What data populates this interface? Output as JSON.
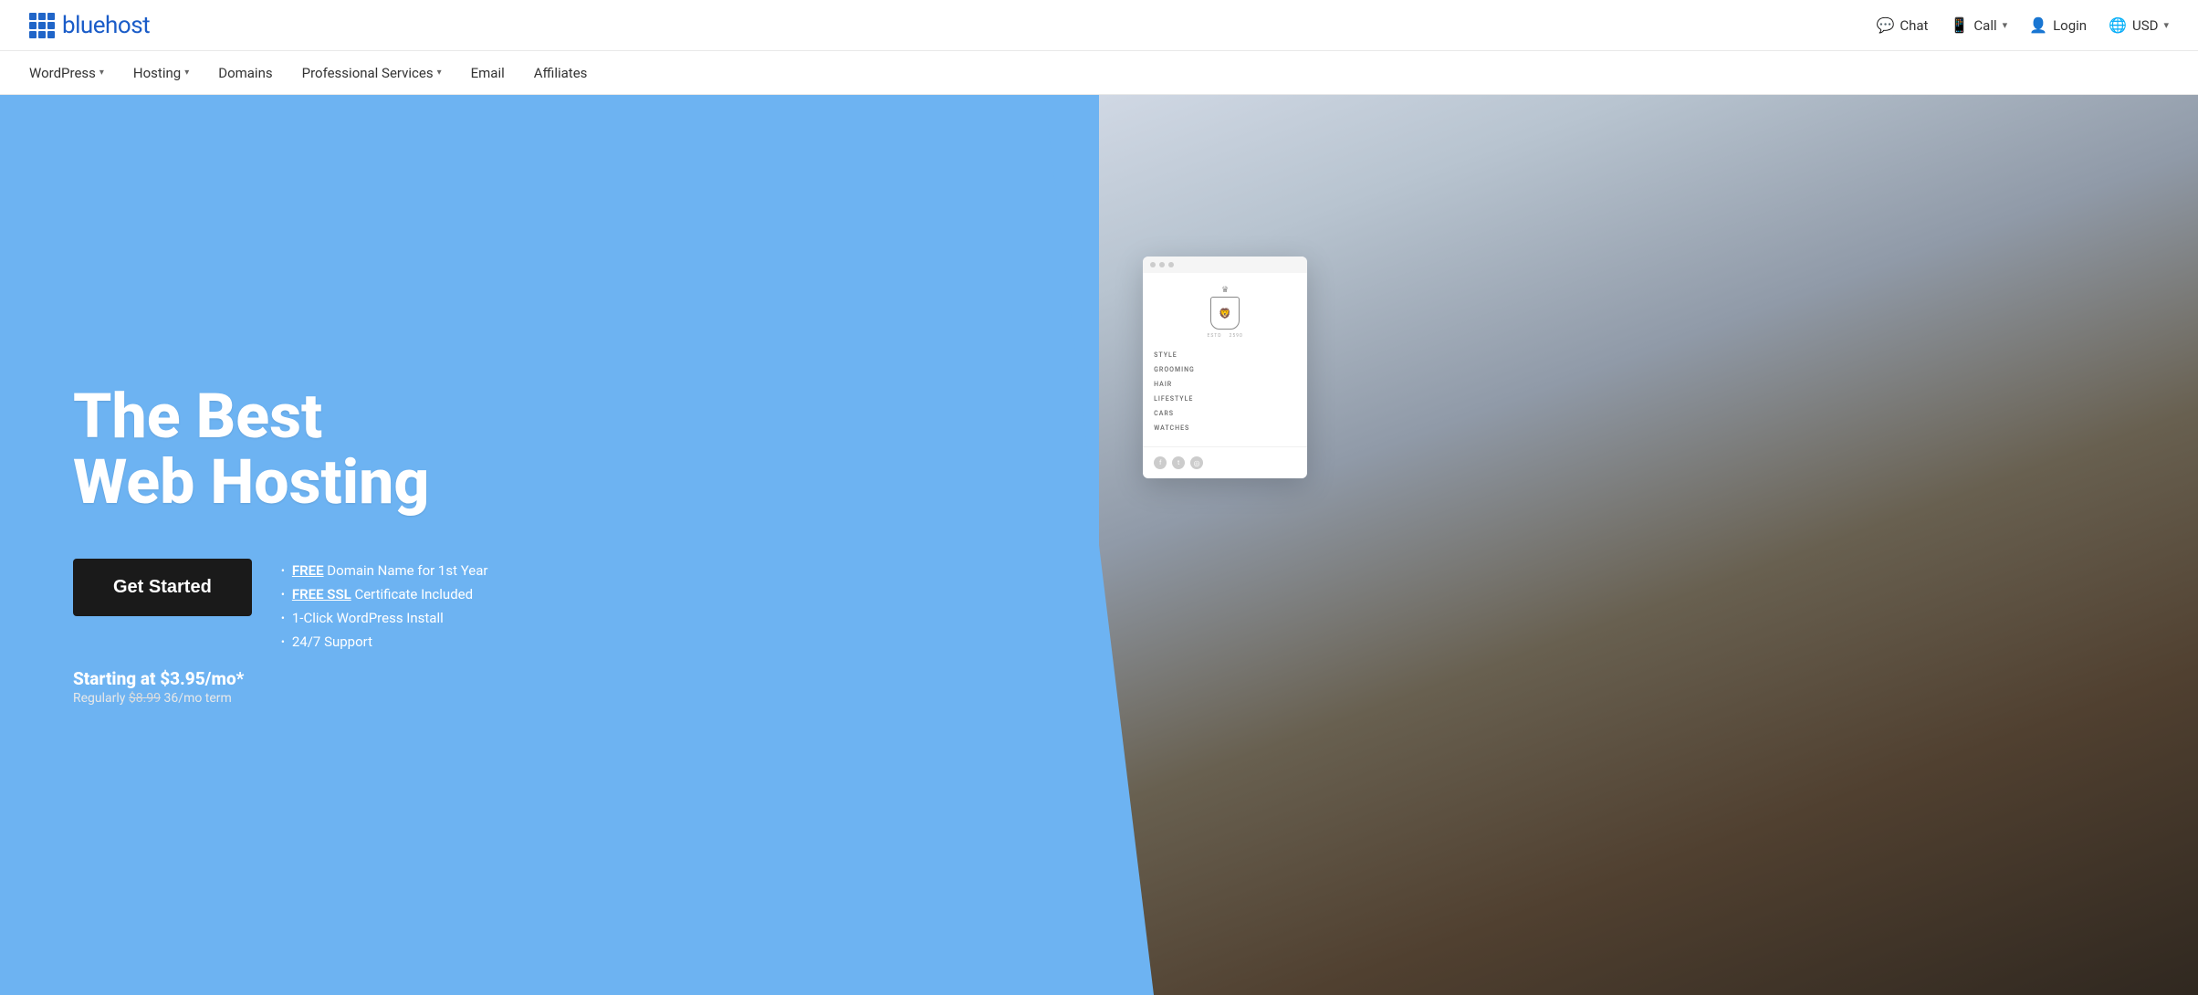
{
  "header": {
    "logo_text": "bluehost",
    "top_actions": [
      {
        "id": "chat",
        "icon": "💬",
        "label": "Chat",
        "has_chevron": false
      },
      {
        "id": "call",
        "icon": "📱",
        "label": "Call",
        "has_chevron": true
      },
      {
        "id": "login",
        "icon": "👤",
        "label": "Login",
        "has_chevron": false
      },
      {
        "id": "currency",
        "icon": "🌐",
        "label": "USD",
        "has_chevron": true
      }
    ]
  },
  "nav": {
    "items": [
      {
        "id": "wordpress",
        "label": "WordPress",
        "has_chevron": true
      },
      {
        "id": "hosting",
        "label": "Hosting",
        "has_chevron": true
      },
      {
        "id": "domains",
        "label": "Domains",
        "has_chevron": false
      },
      {
        "id": "professional-services",
        "label": "Professional Services",
        "has_chevron": true
      },
      {
        "id": "email",
        "label": "Email",
        "has_chevron": false
      },
      {
        "id": "affiliates",
        "label": "Affiliates",
        "has_chevron": false
      }
    ]
  },
  "hero": {
    "headline_line1": "The Best",
    "headline_line2": "Web Hosting",
    "cta_button": "Get Started",
    "features": [
      {
        "id": "domain",
        "text_bold": "FREE",
        "text_rest": " Domain Name for 1st Year"
      },
      {
        "id": "ssl",
        "text_bold": "FREE SSL",
        "text_rest": " Certificate Included"
      },
      {
        "id": "wordpress",
        "text": "1-Click WordPress Install"
      },
      {
        "id": "support",
        "text": "24/7 Support"
      }
    ],
    "pricing_main": "Starting at $3.95/mo*",
    "pricing_regular_prefix": "Regularly ",
    "pricing_strikethrough": "$8.99",
    "pricing_term": " 36/mo term",
    "mockup": {
      "nav_items": [
        "STYLE",
        "GROOMING",
        "HAIR",
        "LIFESTYLE",
        "CARS",
        "WATCHES"
      ],
      "social": [
        "f",
        "t",
        "◎"
      ]
    }
  },
  "colors": {
    "hero_bg": "#6db3f2",
    "brand": "#1a5cc8",
    "cta_bg": "#1a1a1a"
  }
}
